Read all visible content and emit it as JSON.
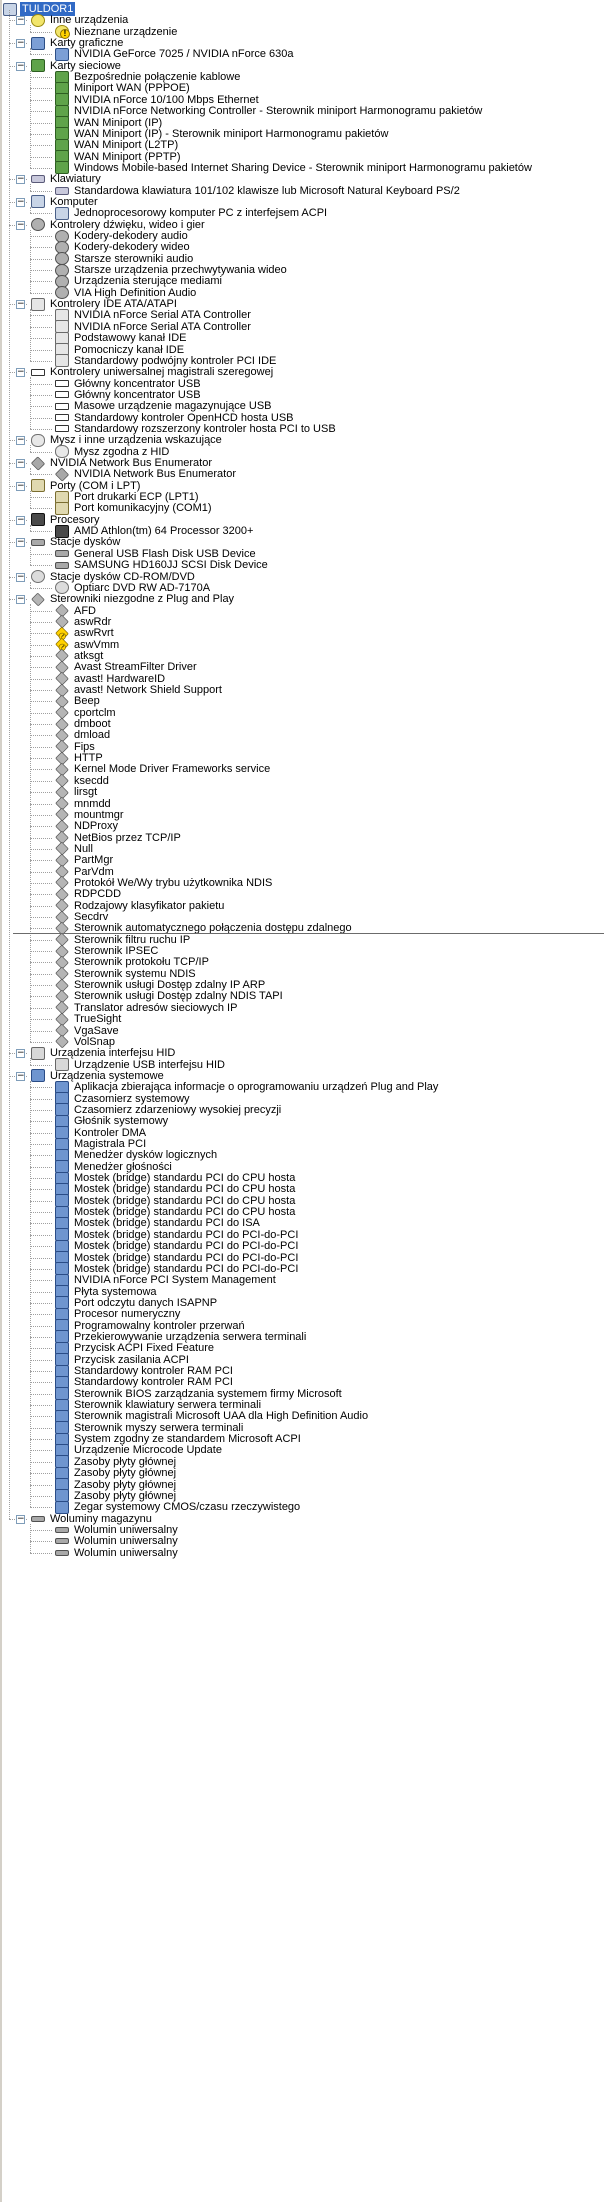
{
  "root": {
    "label": "TULDOR1",
    "icon": "computer-icon"
  },
  "categories": [
    {
      "label": "Inne urządzenia",
      "icon": "unknown-device-icon",
      "items": [
        {
          "label": "Nieznane urządzenie",
          "icon": "unknown-device-warning-icon"
        }
      ]
    },
    {
      "label": "Karty graficzne",
      "icon": "display-adapter-icon",
      "items": [
        {
          "label": "NVIDIA GeForce 7025 / NVIDIA nForce 630a",
          "icon": "display-adapter-icon"
        }
      ]
    },
    {
      "label": "Karty sieciowe",
      "icon": "network-adapter-icon",
      "items": [
        {
          "label": "Bezpośrednie połączenie kablowe",
          "icon": "network-adapter-icon"
        },
        {
          "label": "Miniport WAN (PPPOE)",
          "icon": "network-adapter-icon"
        },
        {
          "label": "NVIDIA nForce 10/100 Mbps Ethernet",
          "icon": "network-adapter-icon"
        },
        {
          "label": "NVIDIA nForce Networking Controller - Sterownik miniport Harmonogramu pakietów",
          "icon": "network-adapter-icon"
        },
        {
          "label": "WAN Miniport (IP)",
          "icon": "network-adapter-icon"
        },
        {
          "label": "WAN Miniport (IP) - Sterownik miniport Harmonogramu pakietów",
          "icon": "network-adapter-icon"
        },
        {
          "label": "WAN Miniport (L2TP)",
          "icon": "network-adapter-icon"
        },
        {
          "label": "WAN Miniport (PPTP)",
          "icon": "network-adapter-icon"
        },
        {
          "label": "Windows Mobile-based Internet Sharing Device - Sterownik miniport Harmonogramu pakietów",
          "icon": "network-adapter-icon"
        }
      ]
    },
    {
      "label": "Klawiatury",
      "icon": "keyboard-icon",
      "items": [
        {
          "label": "Standardowa klawiatura 101/102 klawisze lub Microsoft Natural Keyboard PS/2",
          "icon": "keyboard-icon"
        }
      ]
    },
    {
      "label": "Komputer",
      "icon": "computer-icon",
      "items": [
        {
          "label": "Jednoprocesorowy komputer PC z interfejsem ACPI",
          "icon": "computer-icon"
        }
      ]
    },
    {
      "label": "Kontrolery dźwięku, wideo i gier",
      "icon": "sound-icon",
      "items": [
        {
          "label": "Kodery-dekodery audio",
          "icon": "sound-icon"
        },
        {
          "label": "Kodery-dekodery wideo",
          "icon": "sound-icon"
        },
        {
          "label": "Starsze sterowniki audio",
          "icon": "sound-icon"
        },
        {
          "label": "Starsze urządzenia przechwytywania wideo",
          "icon": "sound-icon"
        },
        {
          "label": "Urządzenia sterujące mediami",
          "icon": "sound-icon"
        },
        {
          "label": "VIA High Definition Audio",
          "icon": "sound-icon"
        }
      ]
    },
    {
      "label": "Kontrolery IDE ATA/ATAPI",
      "icon": "ide-controller-icon",
      "items": [
        {
          "label": "NVIDIA nForce Serial ATA Controller",
          "icon": "ide-controller-icon"
        },
        {
          "label": "NVIDIA nForce Serial ATA Controller",
          "icon": "ide-controller-icon"
        },
        {
          "label": "Podstawowy kanał IDE",
          "icon": "ide-controller-icon"
        },
        {
          "label": "Pomocniczy kanał IDE",
          "icon": "ide-controller-icon"
        },
        {
          "label": "Standardowy podwójny kontroler PCI IDE",
          "icon": "ide-controller-icon"
        }
      ]
    },
    {
      "label": "Kontrolery uniwersalnej magistrali szeregowej",
      "icon": "usb-icon",
      "items": [
        {
          "label": "Główny koncentrator USB",
          "icon": "usb-icon"
        },
        {
          "label": "Główny koncentrator USB",
          "icon": "usb-icon"
        },
        {
          "label": "Masowe urządzenie magazynujące USB",
          "icon": "usb-icon"
        },
        {
          "label": "Standardowy kontroler OpenHCD hosta USB",
          "icon": "usb-icon"
        },
        {
          "label": "Standardowy rozszerzony kontroler hosta PCI to USB",
          "icon": "usb-icon"
        }
      ]
    },
    {
      "label": "Mysz i inne urządzenia wskazujące",
      "icon": "mouse-icon",
      "items": [
        {
          "label": "Mysz zgodna z HID",
          "icon": "mouse-icon"
        }
      ]
    },
    {
      "label": "NVIDIA Network Bus Enumerator",
      "icon": "generic-device-icon",
      "items": [
        {
          "label": "NVIDIA Network Bus Enumerator",
          "icon": "generic-device-icon"
        }
      ]
    },
    {
      "label": "Porty (COM i LPT)",
      "icon": "port-icon",
      "items": [
        {
          "label": "Port drukarki ECP (LPT1)",
          "icon": "port-icon"
        },
        {
          "label": "Port komunikacyjny (COM1)",
          "icon": "port-icon"
        }
      ]
    },
    {
      "label": "Procesory",
      "icon": "processor-icon",
      "items": [
        {
          "label": "AMD Athlon(tm) 64 Processor 3200+",
          "icon": "processor-icon"
        }
      ]
    },
    {
      "label": "Stacje dysków",
      "icon": "disk-drive-icon",
      "items": [
        {
          "label": "General USB Flash Disk USB Device",
          "icon": "disk-drive-icon"
        },
        {
          "label": "SAMSUNG HD160JJ SCSI Disk Device",
          "icon": "disk-drive-icon"
        }
      ]
    },
    {
      "label": "Stacje dysków CD-ROM/DVD",
      "icon": "cdrom-icon",
      "items": [
        {
          "label": "Optiarc DVD RW AD-7170A",
          "icon": "cdrom-icon"
        }
      ]
    },
    {
      "label": "Sterowniki niezgodne z Plug and Play",
      "icon": "driver-icon",
      "items": [
        {
          "label": "AFD",
          "icon": "driver-icon"
        },
        {
          "label": "aswRdr",
          "icon": "driver-icon"
        },
        {
          "label": "aswRvrt",
          "icon": "driver-warning-icon"
        },
        {
          "label": "aswVmm",
          "icon": "driver-warning-icon"
        },
        {
          "label": "atksgt",
          "icon": "driver-icon"
        },
        {
          "label": "Avast StreamFilter Driver",
          "icon": "driver-icon"
        },
        {
          "label": "avast! HardwareID",
          "icon": "driver-icon"
        },
        {
          "label": "avast! Network Shield Support",
          "icon": "driver-icon"
        },
        {
          "label": "Beep",
          "icon": "driver-icon"
        },
        {
          "label": "cportclm",
          "icon": "driver-icon"
        },
        {
          "label": "dmboot",
          "icon": "driver-icon"
        },
        {
          "label": "dmload",
          "icon": "driver-icon"
        },
        {
          "label": "Fips",
          "icon": "driver-icon"
        },
        {
          "label": "HTTP",
          "icon": "driver-icon"
        },
        {
          "label": "Kernel Mode Driver Frameworks service",
          "icon": "driver-icon"
        },
        {
          "label": "ksecdd",
          "icon": "driver-icon"
        },
        {
          "label": "lirsgt",
          "icon": "driver-icon"
        },
        {
          "label": "mnmdd",
          "icon": "driver-icon"
        },
        {
          "label": "mountmgr",
          "icon": "driver-icon"
        },
        {
          "label": "NDProxy",
          "icon": "driver-icon"
        },
        {
          "label": "NetBios przez TCP/IP",
          "icon": "driver-icon"
        },
        {
          "label": "Null",
          "icon": "driver-icon"
        },
        {
          "label": "PartMgr",
          "icon": "driver-icon"
        },
        {
          "label": "ParVdm",
          "icon": "driver-icon"
        },
        {
          "label": "Protokół We/Wy trybu użytkownika NDIS",
          "icon": "driver-icon"
        },
        {
          "label": "RDPCDD",
          "icon": "driver-icon"
        },
        {
          "label": "Rodzajowy klasyfikator pakietu",
          "icon": "driver-icon"
        },
        {
          "label": "Secdrv",
          "icon": "driver-icon"
        },
        {
          "label": "Sterownik automatycznego połączenia dostępu zdalnego",
          "icon": "driver-icon"
        },
        {
          "label": "Sterownik filtru ruchu IP",
          "icon": "driver-icon"
        },
        {
          "label": "Sterownik IPSEC",
          "icon": "driver-icon"
        },
        {
          "label": "Sterownik protokołu TCP/IP",
          "icon": "driver-icon"
        },
        {
          "label": "Sterownik systemu NDIS",
          "icon": "driver-icon"
        },
        {
          "label": "Sterownik usługi Dostęp zdalny IP ARP",
          "icon": "driver-icon"
        },
        {
          "label": "Sterownik usługi Dostęp zdalny NDIS TAPI",
          "icon": "driver-icon"
        },
        {
          "label": "Translator adresów sieciowych IP",
          "icon": "driver-icon"
        },
        {
          "label": "TrueSight",
          "icon": "driver-icon"
        },
        {
          "label": "VgaSave",
          "icon": "driver-icon"
        },
        {
          "label": "VolSnap",
          "icon": "driver-icon"
        }
      ]
    },
    {
      "label": "Urządzenia interfejsu HID",
      "icon": "hid-icon",
      "items": [
        {
          "label": "Urządzenie USB interfejsu HID",
          "icon": "hid-icon"
        }
      ]
    },
    {
      "label": "Urządzenia systemowe",
      "icon": "system-device-icon",
      "items": [
        {
          "label": "Aplikacja zbierająca informacje o oprogramowaniu urządzeń Plug and Play",
          "icon": "system-device-icon"
        },
        {
          "label": "Czasomierz systemowy",
          "icon": "system-device-icon"
        },
        {
          "label": "Czasomierz zdarzeniowy wysokiej precyzji",
          "icon": "system-device-icon"
        },
        {
          "label": "Głośnik systemowy",
          "icon": "system-device-icon"
        },
        {
          "label": "Kontroler DMA",
          "icon": "system-device-icon"
        },
        {
          "label": "Magistrala PCI",
          "icon": "system-device-icon"
        },
        {
          "label": "Menedżer dysków logicznych",
          "icon": "system-device-icon"
        },
        {
          "label": "Menedżer głośności",
          "icon": "system-device-icon"
        },
        {
          "label": "Mostek (bridge) standardu PCI do CPU hosta",
          "icon": "system-device-icon"
        },
        {
          "label": "Mostek (bridge) standardu PCI do CPU hosta",
          "icon": "system-device-icon"
        },
        {
          "label": "Mostek (bridge) standardu PCI do CPU hosta",
          "icon": "system-device-icon"
        },
        {
          "label": "Mostek (bridge) standardu PCI do CPU hosta",
          "icon": "system-device-icon"
        },
        {
          "label": "Mostek (bridge) standardu PCI do ISA",
          "icon": "system-device-icon"
        },
        {
          "label": "Mostek (bridge) standardu PCI do PCI-do-PCI",
          "icon": "system-device-icon"
        },
        {
          "label": "Mostek (bridge) standardu PCI do PCI-do-PCI",
          "icon": "system-device-icon"
        },
        {
          "label": "Mostek (bridge) standardu PCI do PCI-do-PCI",
          "icon": "system-device-icon"
        },
        {
          "label": "Mostek (bridge) standardu PCI do PCI-do-PCI",
          "icon": "system-device-icon"
        },
        {
          "label": "NVIDIA nForce PCI System Management",
          "icon": "system-device-icon"
        },
        {
          "label": "Płyta systemowa",
          "icon": "system-device-icon"
        },
        {
          "label": "Port odczytu danych ISAPNP",
          "icon": "system-device-icon"
        },
        {
          "label": "Procesor numeryczny",
          "icon": "system-device-icon"
        },
        {
          "label": "Programowalny kontroler przerwań",
          "icon": "system-device-icon"
        },
        {
          "label": "Przekierowywanie urządzenia serwera terminali",
          "icon": "system-device-icon"
        },
        {
          "label": "Przycisk ACPI Fixed Feature",
          "icon": "system-device-icon"
        },
        {
          "label": "Przycisk zasilania ACPI",
          "icon": "system-device-icon"
        },
        {
          "label": "Standardowy kontroler RAM PCI",
          "icon": "system-device-icon"
        },
        {
          "label": "Standardowy kontroler RAM PCI",
          "icon": "system-device-icon"
        },
        {
          "label": "Sterownik BIOS zarządzania systemem firmy Microsoft",
          "icon": "system-device-icon"
        },
        {
          "label": "Sterownik klawiatury serwera terminali",
          "icon": "system-device-icon"
        },
        {
          "label": "Sterownik magistrali Microsoft UAA dla High Definition Audio",
          "icon": "system-device-icon"
        },
        {
          "label": "Sterownik myszy serwera terminali",
          "icon": "system-device-icon"
        },
        {
          "label": "System zgodny ze standardem Microsoft ACPI",
          "icon": "system-device-icon"
        },
        {
          "label": "Urządzenie Microcode Update",
          "icon": "system-device-icon"
        },
        {
          "label": "Zasoby płyty głównej",
          "icon": "system-device-icon"
        },
        {
          "label": "Zasoby płyty głównej",
          "icon": "system-device-icon"
        },
        {
          "label": "Zasoby płyty głównej",
          "icon": "system-device-icon"
        },
        {
          "label": "Zasoby płyty głównej",
          "icon": "system-device-icon"
        },
        {
          "label": "Zegar systemowy CMOS/czasu rzeczywistego",
          "icon": "system-device-icon"
        }
      ]
    },
    {
      "label": "Woluminy magazynu",
      "icon": "volume-icon",
      "items": [
        {
          "label": "Wolumin uniwersalny",
          "icon": "volume-icon"
        },
        {
          "label": "Wolumin uniwersalny",
          "icon": "volume-icon"
        },
        {
          "label": "Wolumin uniwersalny",
          "icon": "volume-icon"
        }
      ]
    }
  ],
  "colors": {
    "selection": "#316ac5",
    "tree_lines": "#a0a0a0",
    "expander_border": "#7f9db9",
    "warning": "#ffd200"
  }
}
